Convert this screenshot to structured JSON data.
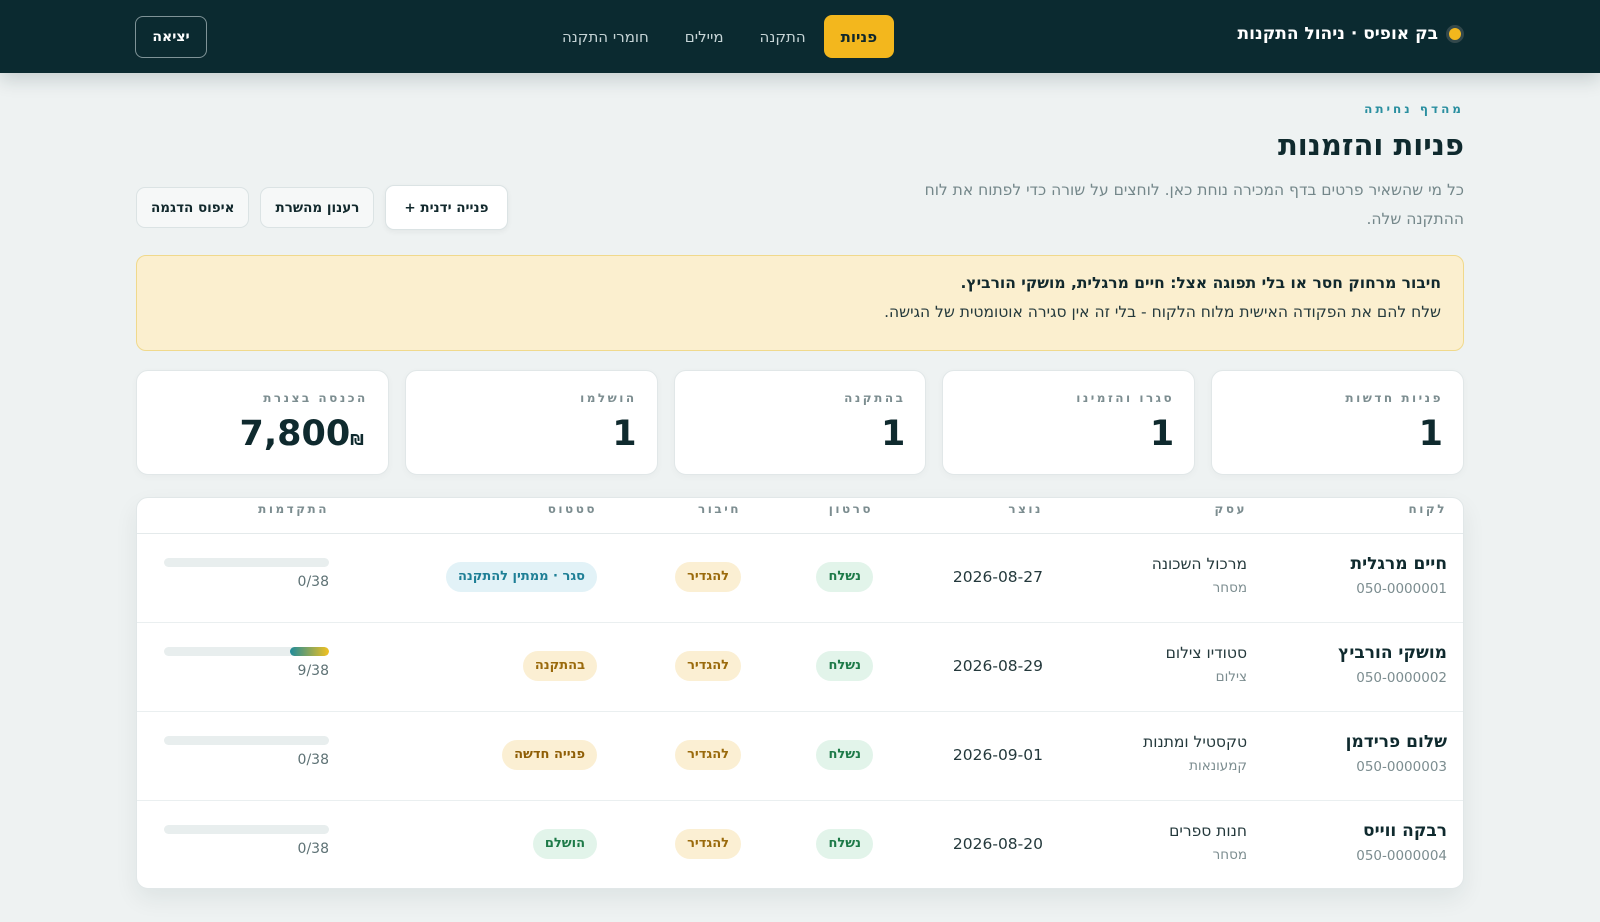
{
  "app": {
    "brand": "בק אופיס · ניהול התקנות",
    "nav": [
      {
        "label": "פניות",
        "active": true
      },
      {
        "label": "התקנה",
        "active": false
      },
      {
        "label": "מיילים",
        "active": false
      },
      {
        "label": "חומרי התקנה",
        "active": false
      }
    ],
    "logout_label": "יציאה"
  },
  "header": {
    "eyebrow": "מהדף נחיתה",
    "title": "פניות והזמנות",
    "description": "כל מי שהשאיר פרטים בדף המכירה נוחת כאן. לוחצים על שורה כדי לפתוח את לוח ההתקנה שלה."
  },
  "actions": {
    "manual_label": "+ פנייה ידנית",
    "refresh_label": "רענון מהשרת",
    "reset_label": "איפוס הדגמה"
  },
  "alert": {
    "title": "חיבור מרחוק חסר או בלי תפוגה אצל: חיים מרגלית, מושקי הורביץ.",
    "text": "שלח להם את הפקודה האישית מלוח הלקוח - בלי זה אין סגירה אוטומטית של הגישה."
  },
  "stats": [
    {
      "label": "פניות חדשות",
      "value": "1",
      "unit": ""
    },
    {
      "label": "סגרו והזמינו",
      "value": "1",
      "unit": ""
    },
    {
      "label": "בהתקנה",
      "value": "1",
      "unit": ""
    },
    {
      "label": "הושלמו",
      "value": "1",
      "unit": ""
    },
    {
      "label": "הכנסה בצנרת",
      "value": "7,800",
      "unit": "₪"
    }
  ],
  "table": {
    "headers": {
      "client": "לקוח",
      "business": "עסק",
      "created": "נוצר",
      "video": "סרטון",
      "connection": "חיבור",
      "status": "סטטוס",
      "progress": "התקדמות"
    },
    "rows": [
      {
        "name": "חיים מרגלית",
        "phone": "050-0000001",
        "business": "מרכול השכונה",
        "category": "מסחר",
        "created": "2026-08-27",
        "video": "נשלח",
        "connection": "להגדיר",
        "status": "סגר · ממתין להתקנה",
        "status_kind": "blue",
        "progress_text": "0/38",
        "progress": 0
      },
      {
        "name": "מושקי הורביץ",
        "phone": "050-0000002",
        "business": "סטודיו צילום",
        "category": "צילום",
        "created": "2026-08-29",
        "video": "נשלח",
        "connection": "להגדיר",
        "status": "בהתקנה",
        "status_kind": "amber",
        "progress_text": "9/38",
        "progress": 0.237
      },
      {
        "name": "שלום פרידמן",
        "phone": "050-0000003",
        "business": "טקסטיל ומתנות",
        "category": "קמעונאות",
        "created": "2026-09-01",
        "video": "נשלח",
        "connection": "להגדיר",
        "status": "פנייה חדשה",
        "status_kind": "new",
        "progress_text": "0/38",
        "progress": 0
      },
      {
        "name": "רבקה ווייס",
        "phone": "050-0000004",
        "business": "חנות ספרים",
        "category": "מסחר",
        "created": "2026-08-20",
        "video": "נשלח",
        "connection": "להגדיר",
        "status": "הושלם",
        "status_kind": "green",
        "progress_text": "0/38",
        "progress": 0
      }
    ]
  }
}
